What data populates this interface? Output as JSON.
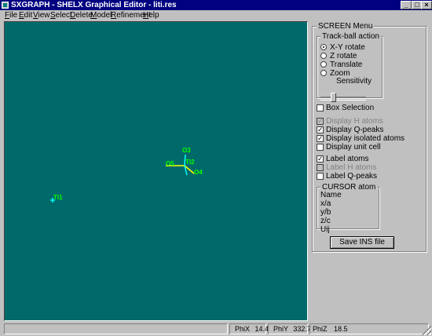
{
  "window": {
    "title": "SXGRAPH - SHELX Graphical Editor - liti.res"
  },
  "menu": [
    {
      "first": "F",
      "rest": "ile"
    },
    {
      "first": "E",
      "rest": "dit"
    },
    {
      "first": "V",
      "rest": "iew"
    },
    {
      "first": "S",
      "rest": "elect"
    },
    {
      "first": "D",
      "rest": "elete"
    },
    {
      "first": "M",
      "rest": "odel"
    },
    {
      "first": "R",
      "rest": "efinement"
    },
    {
      "first": "H",
      "rest": "elp"
    }
  ],
  "molecule": {
    "atoms": [
      {
        "label": "O3"
      },
      {
        "label": "O5"
      },
      {
        "label": "TI2"
      },
      {
        "label": "O4"
      },
      {
        "label": "TI1"
      }
    ]
  },
  "screen_menu": {
    "title": "SCREEN Menu",
    "trackball": {
      "title": "Track-ball action",
      "options": [
        "X-Y rotate",
        "Z rotate",
        "Translate",
        "Zoom"
      ],
      "selected": 0,
      "sensitivity_label": "Sensitivity",
      "sensitivity_value": 0.25
    },
    "box_selection": {
      "label": "Box Selection",
      "checked": false
    },
    "display": [
      {
        "label": "Display H atoms",
        "checked": true,
        "disabled": true
      },
      {
        "label": "Display Q-peaks",
        "checked": true,
        "disabled": false
      },
      {
        "label": "Display isolated atoms",
        "checked": true,
        "disabled": false
      },
      {
        "label": "Display unit cell",
        "checked": false,
        "disabled": false
      }
    ],
    "labels": [
      {
        "label": "Label atoms",
        "checked": true,
        "disabled": false
      },
      {
        "label": "Label H atoms",
        "checked": false,
        "disabled": true
      },
      {
        "label": "Label Q-peaks",
        "checked": false,
        "disabled": false
      }
    ],
    "cursor_atom": {
      "title": "CURSOR atom",
      "fields": [
        "Name",
        "x/a",
        "y/b",
        "z/c",
        "Uij"
      ]
    },
    "save_button": "Save INS file"
  },
  "status": {
    "phix_label": "PhiX",
    "phix": "14.4",
    "phiy_label": "PhiY",
    "phiy": "332.7",
    "phiz_label": "PhiZ",
    "phiz": "18.5"
  },
  "colors": {
    "canvas": "#006a6a",
    "atom_label": "#00ff00",
    "bond_cyan": "#00ffff",
    "bond_yellow": "#ffff00"
  }
}
